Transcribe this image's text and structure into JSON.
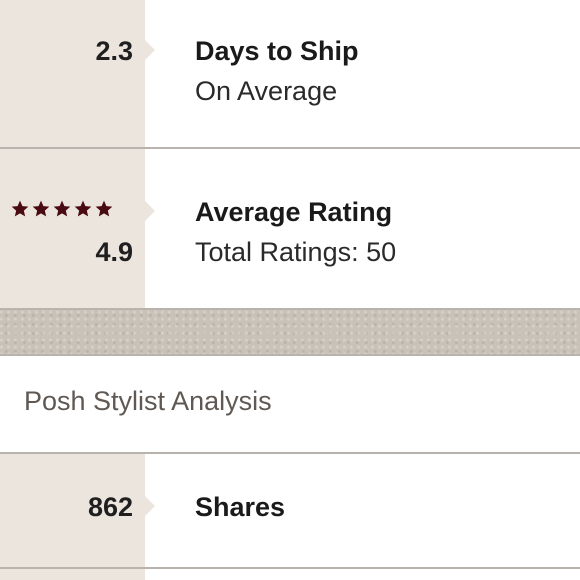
{
  "rows": [
    {
      "value": "2.3",
      "title": "Days to Ship",
      "subtitle": "On Average"
    },
    {
      "rating_stars": 5,
      "value": "4.9",
      "title": "Average Rating",
      "subtitle": "Total Ratings: 50"
    }
  ],
  "section_header": "Posh Stylist Analysis",
  "shares": {
    "value": "862",
    "title": "Shares"
  },
  "colors": {
    "left_panel": "#ece5de",
    "star": "#4a0a12",
    "divider": "#b9b3ad"
  }
}
